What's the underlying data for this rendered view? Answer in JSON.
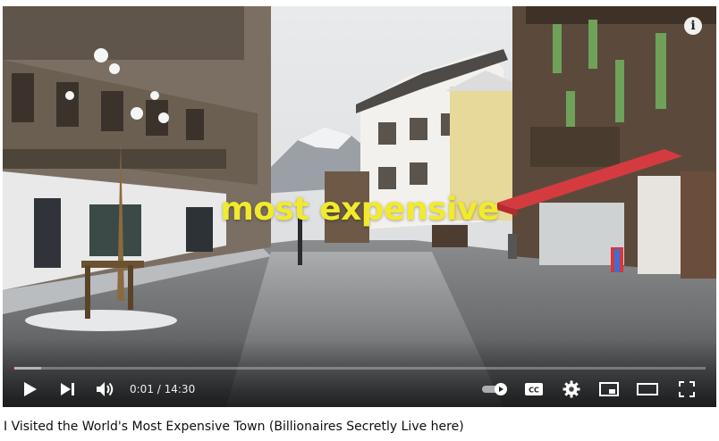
{
  "video": {
    "caption": "most expensive",
    "caption_color": "#f2ea2c",
    "title": "I Visited the World's Most Expensive Town (Billionaires Secretly Live here)",
    "scene_description_icon": "street-scene"
  },
  "player": {
    "info_label": "i",
    "current_time": "0:01",
    "duration": "14:30",
    "time_display": "0:01 / 14:30",
    "played_fraction": 0.001,
    "loaded_fraction": 0.04,
    "progress_color": "#ff0000",
    "autoplay_on": true,
    "controls": {
      "play_icon": "play-icon",
      "next_icon": "next-icon",
      "volume_icon": "volume-icon",
      "autoplay_icon": "autoplay-toggle-icon",
      "cc_icon": "subtitles-icon",
      "cc_label": "CC",
      "settings_icon": "gear-icon",
      "miniplayer_icon": "miniplayer-icon",
      "theater_icon": "theater-icon",
      "fullscreen_icon": "fullscreen-icon"
    }
  }
}
